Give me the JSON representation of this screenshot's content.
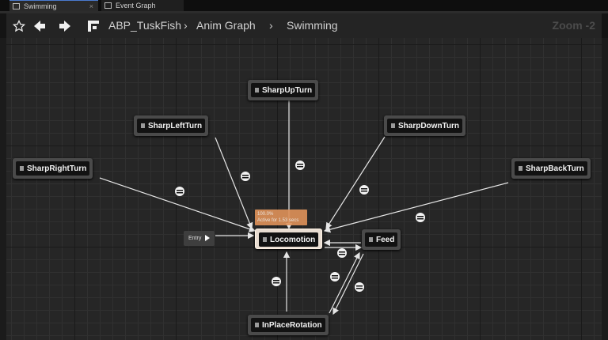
{
  "tabs": [
    {
      "label": "Swimming",
      "active": true
    },
    {
      "label": "Event Graph",
      "active": false
    }
  ],
  "toolbar": {
    "breadcrumb": {
      "asset": "ABP_TuskFish",
      "graph": "Anim Graph",
      "state_machine": "Swimming"
    },
    "zoom": "Zoom -2"
  },
  "graph": {
    "entry_label": "Entry",
    "active_state": {
      "label_line1": "100.0%",
      "label_line2": "Active for 1.53 secs"
    },
    "states": {
      "sharp_up_turn": "SharpUpTurn",
      "sharp_left_turn": "SharpLeftTurn",
      "sharp_down_turn": "SharpDownTurn",
      "sharp_right_turn": "SharpRightTurn",
      "sharp_back_turn": "SharpBackTurn",
      "locomotion": "Locomotion",
      "feed": "Feed",
      "in_place_rotation": "InPlaceRotation"
    }
  },
  "colors": {
    "wire": "#e6e6e6",
    "active_label": "#e0925a",
    "active_node_border": "#fff3e6",
    "grid": "#262626"
  }
}
